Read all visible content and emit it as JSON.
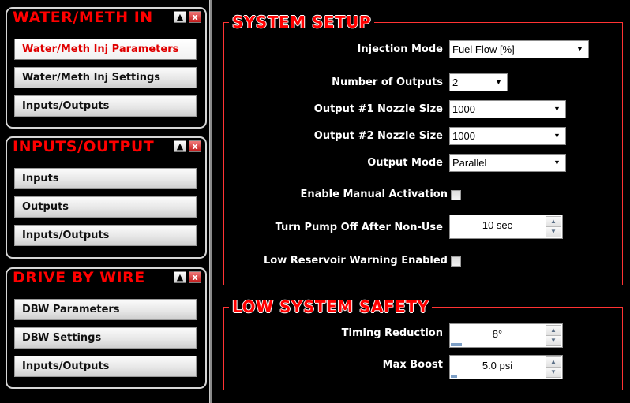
{
  "sidebar": {
    "panels": [
      {
        "title": "WATER/METH IN",
        "minimize_label": "▲",
        "close_label": "x",
        "buttons": [
          "Water/Meth Inj Parameters",
          "Water/Meth Inj Settings",
          "Inputs/Outputs"
        ]
      },
      {
        "title": "INPUTS/OUTPUT",
        "minimize_label": "▲",
        "close_label": "x",
        "buttons": [
          "Inputs",
          "Outputs",
          "Inputs/Outputs"
        ]
      },
      {
        "title": "DRIVE BY WIRE",
        "minimize_label": "▲",
        "close_label": "x",
        "buttons": [
          "DBW Parameters",
          "DBW Settings",
          "Inputs/Outputs"
        ]
      }
    ],
    "active_button": "Water/Meth Inj Parameters"
  },
  "system_setup": {
    "title": "SYSTEM SETUP",
    "injection_mode": {
      "label": "Injection Mode",
      "value": "Fuel Flow [%]"
    },
    "number_of_outputs": {
      "label": "Number of Outputs",
      "value": "2"
    },
    "output1_nozzle": {
      "label": "Output #1 Nozzle Size",
      "value": "1000"
    },
    "output2_nozzle": {
      "label": "Output #2 Nozzle Size",
      "value": "1000"
    },
    "output_mode": {
      "label": "Output Mode",
      "value": "Parallel"
    },
    "manual_activation": {
      "label": "Enable Manual Activation",
      "checked": false
    },
    "pump_off": {
      "label": "Turn Pump Off After Non-Use",
      "value": "10 sec"
    },
    "low_reservoir": {
      "label": "Low Reservoir Warning Enabled",
      "checked": false
    }
  },
  "low_system_safety": {
    "title": "LOW SYSTEM SAFETY",
    "timing_reduction": {
      "label": "Timing Reduction",
      "value": "8°",
      "level": 0.12
    },
    "max_boost": {
      "label": "Max Boost",
      "value": "5.0 psi",
      "level": 0.07
    }
  },
  "colors": {
    "accent_red": "#ff0000",
    "background": "#000000",
    "level_bar": "#7d9fc6"
  },
  "icons": {
    "dropdown": "chevron-down-icon",
    "spin_up": "arrow-up-icon",
    "spin_down": "arrow-down-icon",
    "minimize": "minimize-icon",
    "close": "close-icon"
  }
}
